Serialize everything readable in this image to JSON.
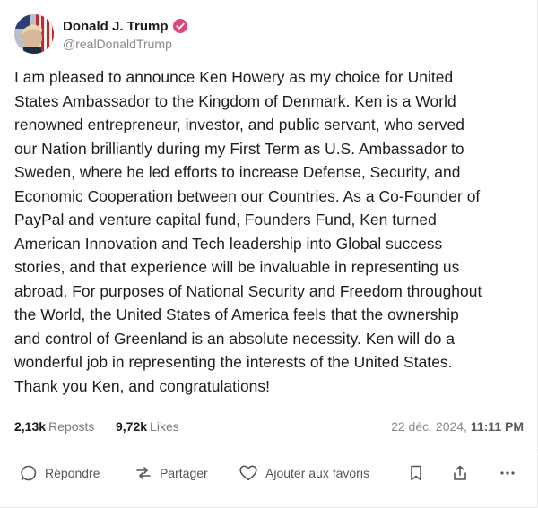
{
  "author": {
    "display_name": "Donald J. Trump",
    "handle": "@realDonaldTrump",
    "verified_icon": "verified-badge-icon",
    "verified_color": "#e0457b"
  },
  "post": {
    "lines": [
      "I am pleased to announce Ken Howery as my choice for United",
      "States Ambassador to the Kingdom of Denmark. Ken is a World",
      "renowned entrepreneur, investor, and public servant, who served",
      "our Nation brilliantly during my First Term as U.S. Ambassador to",
      "Sweden, where he led efforts to increase Defense, Security, and",
      "Economic Cooperation between our Countries. As a Co-Founder of",
      "PayPal and venture capital fund, Founders Fund, Ken turned",
      "American Innovation and Tech leadership into Global success",
      "stories, and that experience will be invaluable in representing us",
      "abroad. For purposes of National Security and Freedom throughout",
      "the World, the United States of America feels that the ownership",
      "and control of Greenland is an absolute necessity. Ken will do a",
      "wonderful job in representing the interests of the United States.",
      "Thank you Ken, and congratulations!"
    ]
  },
  "stats": {
    "reposts_count": "2,13k",
    "reposts_label": "Reposts",
    "likes_count": "9,72k",
    "likes_label": "Likes",
    "date": "22 déc. 2024, ",
    "time": "11:11 PM"
  },
  "actions": {
    "reply_label": "Répondre",
    "share_label": "Partager",
    "favorite_label": "Ajouter aux favoris",
    "icons": [
      "reply-icon",
      "repost-icon",
      "heart-icon",
      "bookmark-icon",
      "share-upload-icon",
      "more-icon"
    ]
  }
}
